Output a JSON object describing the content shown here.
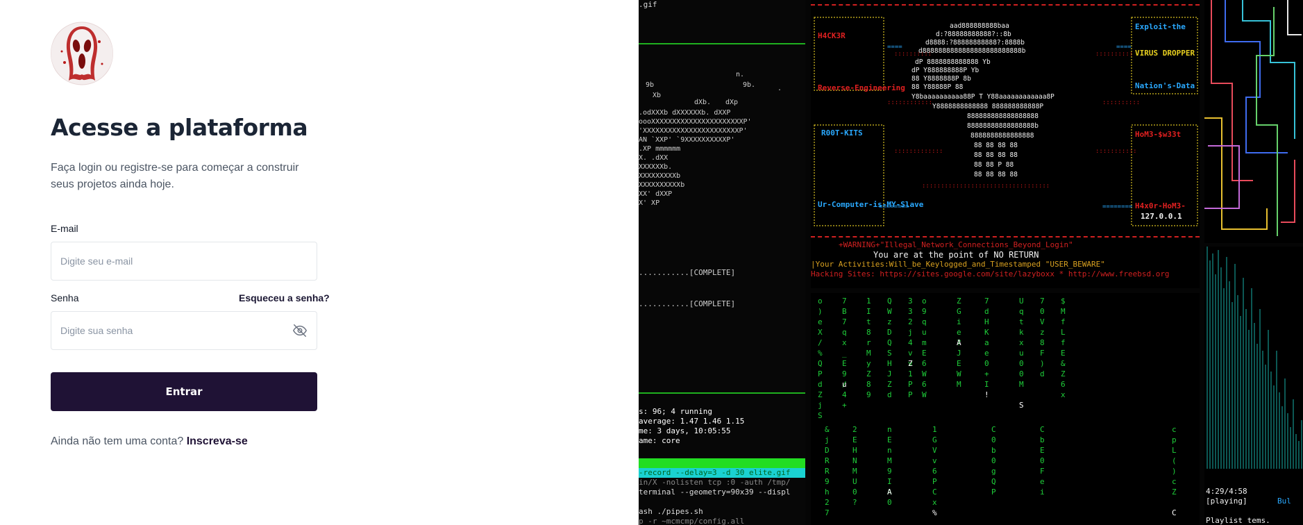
{
  "login": {
    "title": "Acesse a plataforma",
    "subtitle": "Faça login ou registre-se para começar a construir seus projetos ainda hoje.",
    "email_label": "E-mail",
    "email_placeholder": "Digite seu e-mail",
    "password_label": "Senha",
    "forgot_link": "Esqueceu a senha?",
    "password_placeholder": "Digite sua senha",
    "submit_label": "Entrar",
    "signup_prompt": "Ainda não tem uma conta?",
    "signup_link": "Inscreva-se"
  },
  "terminal": {
    "file": ".gif",
    "complete1": "...........[COMPLETE]",
    "complete2": "...........[COMPLETE]",
    "running": "s: 96; 4 running",
    "load": "average: 1.47 1.46 1.15",
    "uptime": "me: 3 days, 10:05:55",
    "name": "ame: core",
    "cmd1": "-record --delay=3 -d 30 elite.gif",
    "cmd2": "in/X -nolisten tcp :0 -auth /tmp/",
    "cmd3": "terminal --geometry=90x39 --displ",
    "cmd4": "ash ./pipes.sh",
    "cmd5": "p -r ~mcmcmp/config.all",
    "hacker": "H4CK3R",
    "rootkits": "R00T-KITS",
    "reverse": "Reverse-Engineering",
    "exploit": "Exploit-the",
    "virus": "VIRUS DROPPER ?",
    "nations": "Nation's-Data",
    "homs": "HoM3-$w33t",
    "ur_computer": "Ur-Computer-is-MY-Slave",
    "h4x0r": "H4x0r-HoM3-",
    "localhost": "127.0.0.1",
    "warning": "+WARNING+\"Illegal_Network_Connections_Beyond_Login\"",
    "point": "You are at the point of NO RETURN",
    "activities": "|Your Activities:Will_be_Keylogged_and_Timestamped \"USER_BEWARE\"",
    "sites": "Hacking Sites: https://sites.google.com/site/lazyboxx * http://www.freebsd.org",
    "time": "4:29/4:58",
    "playing": "[playing]",
    "playlist": "Playlist tems.",
    "bul": "Bul"
  }
}
